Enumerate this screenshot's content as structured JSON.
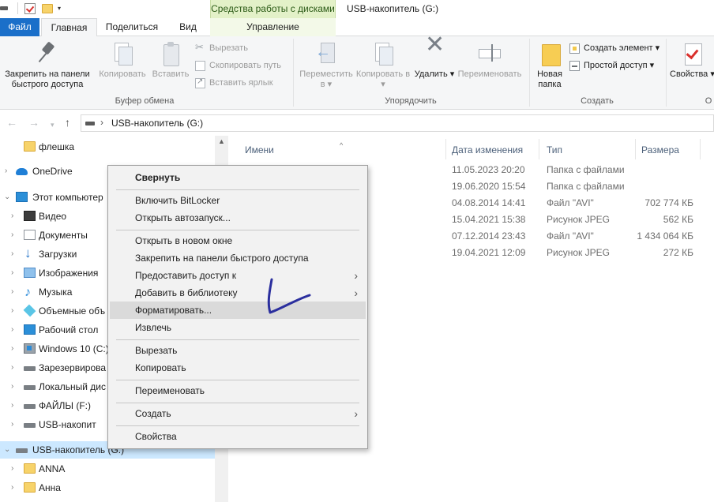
{
  "titlebar": {
    "contextual_tab_title": "Средства работы с дисками",
    "window_title": "USB-накопитель (G:)"
  },
  "tabs": {
    "file": "Файл",
    "home": "Главная",
    "share": "Поделиться",
    "view": "Вид",
    "manage": "Управление"
  },
  "ribbon": {
    "clipboard": {
      "pin": "Закрепить на панели быстрого доступа",
      "copy": "Копировать",
      "paste": "Вставить",
      "cut": "Вырезать",
      "copy_path": "Скопировать путь",
      "paste_shortcut": "Вставить ярлык",
      "label": "Буфер обмена"
    },
    "organize": {
      "move_to": "Переместить в ▾",
      "copy_to": "Копировать в ▾",
      "delete": "Удалить ▾",
      "rename": "Переименовать",
      "label": "Упорядочить"
    },
    "new": {
      "new_folder": "Новая папка",
      "new_item": "Создать элемент ▾",
      "easy_access": "Простой доступ ▾",
      "label": "Создать"
    },
    "open": {
      "properties": "Свойства ▾",
      "label": "О"
    }
  },
  "address": {
    "path": "USB-накопитель (G:)"
  },
  "nav_tree": [
    {
      "label": "флешка",
      "icon": "folder-icon"
    },
    {
      "label": "OneDrive",
      "icon": "cloud-icon"
    },
    {
      "label": "Этот компьютер",
      "icon": "computer-icon"
    },
    {
      "label": "Видео",
      "icon": "video-icon"
    },
    {
      "label": "Документы",
      "icon": "documents-icon"
    },
    {
      "label": "Загрузки",
      "icon": "downloads-icon"
    },
    {
      "label": "Изображения",
      "icon": "images-icon"
    },
    {
      "label": "Музыка",
      "icon": "music-icon"
    },
    {
      "label": "Объемные объ",
      "icon": "3d-objects-icon"
    },
    {
      "label": "Рабочий стол",
      "icon": "desktop-icon"
    },
    {
      "label": "Windows 10 (C:)",
      "icon": "windows-drive-icon"
    },
    {
      "label": "Зарезервирова",
      "icon": "drive-icon"
    },
    {
      "label": "Локальный дис",
      "icon": "drive-icon"
    },
    {
      "label": "ФАЙЛЫ (F:)",
      "icon": "drive-icon"
    },
    {
      "label": "USB-накопит",
      "icon": "drive-icon"
    },
    {
      "label": "USB-накопитель (G:)",
      "icon": "drive-icon"
    },
    {
      "label": "ANNA",
      "icon": "folder-icon"
    },
    {
      "label": "Анна",
      "icon": "folder-icon"
    }
  ],
  "columns": {
    "name": "Имени",
    "date": "Дата изменения",
    "type": "Тип",
    "size": "Размера"
  },
  "files": [
    {
      "date": "11.05.2023 20:20",
      "type": "Папка с файлами",
      "size": ""
    },
    {
      "date": "19.06.2020 15:54",
      "type": "Папка с файлами",
      "size": ""
    },
    {
      "date": "04.08.2014 14:41",
      "type": "Файл \"AVI\"",
      "size": "702 774 КБ"
    },
    {
      "date": "15.04.2021 15:38",
      "type": "Рисунок JPEG",
      "size": "562 КБ"
    },
    {
      "date": "07.12.2014 23:43",
      "type": "Файл \"AVI\"",
      "size": "1 434 064 КБ"
    },
    {
      "date": "19.04.2021 12:09",
      "type": "Рисунок JPEG",
      "size": "272 КБ"
    }
  ],
  "context_menu": {
    "collapse": "Свернуть",
    "bitlocker": "Включить BitLocker",
    "autoplay": "Открыть автозапуск...",
    "open_new_window": "Открыть в новом окне",
    "pin_quick_access": "Закрепить на панели быстрого доступа",
    "give_access": "Предоставить доступ к",
    "add_library": "Добавить в библиотеку",
    "format": "Форматировать...",
    "eject": "Извлечь",
    "cut": "Вырезать",
    "copy": "Копировать",
    "rename": "Переименовать",
    "create": "Создать",
    "properties": "Свойства"
  },
  "colors": {
    "file_tab": "#1a6fc9",
    "contextual_tab": "#e3f1c8",
    "selection": "#cce8ff",
    "menu_hover": "#dadada",
    "annotation_ink": "#2b2f9e"
  }
}
